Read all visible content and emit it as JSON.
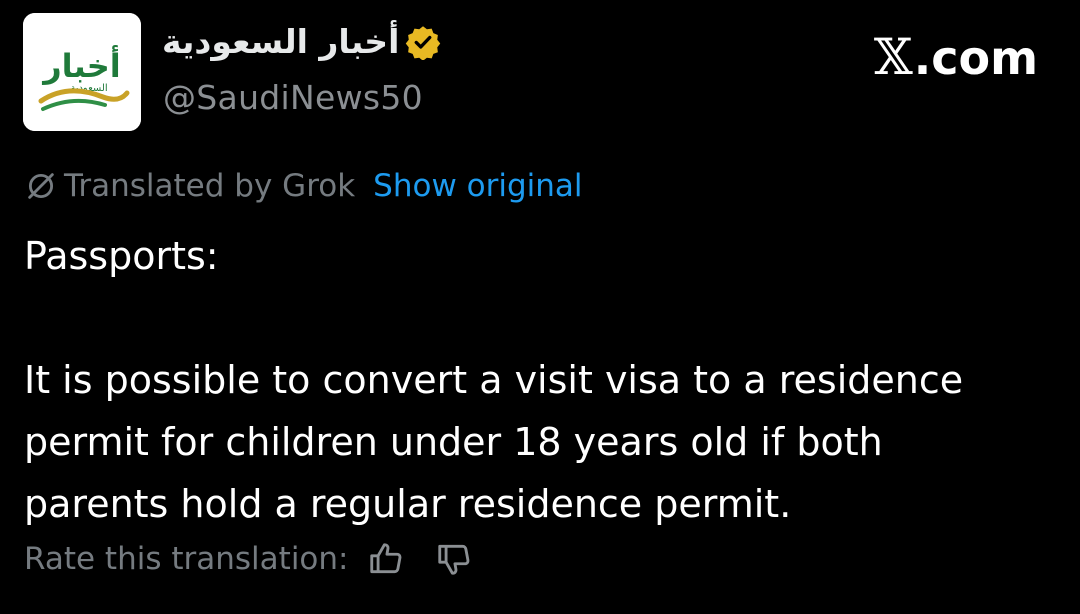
{
  "header": {
    "display_name": "أخبار السعودية",
    "handle": "@SaudiNews50",
    "avatar_icon": "saudi-news-logo-icon",
    "avatar_logo_text": "أخبار",
    "avatar_logo_subtext": "السعودية",
    "verified_icon": "verified-gold-badge-icon",
    "verified_color": "#e8b923"
  },
  "brand": {
    "x_glyph": "𝕏",
    "suffix": ".com"
  },
  "translation": {
    "icon": "grok-icon",
    "translated_by": "Translated by Grok",
    "show_original": "Show original",
    "link_color": "#1d9bf0"
  },
  "tweet": {
    "text": "Passports:\n\nIt is possible to convert a visit visa to a residence permit for children under 18 years old if both parents hold a regular residence permit."
  },
  "rating": {
    "label": "Rate this translation:",
    "thumbs_up_icon": "thumbs-up-icon",
    "thumbs_down_icon": "thumbs-down-icon"
  }
}
